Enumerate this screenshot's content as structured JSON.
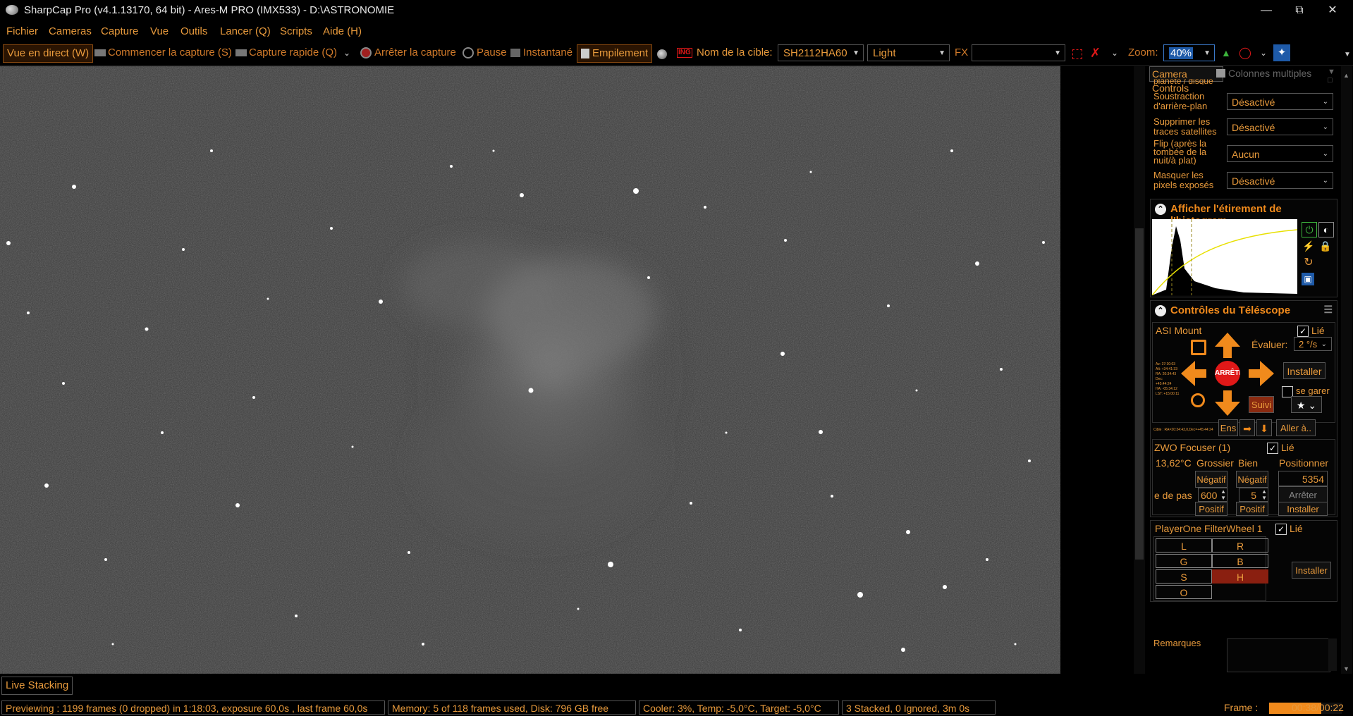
{
  "window": {
    "title": "SharpCap Pro (v4.1.13170, 64 bit) - Ares-M PRO (IMX533) - D:\\ASTRONOMIE"
  },
  "menu": [
    "Fichier",
    "Cameras",
    "Capture",
    "Vue",
    "Outils",
    "Lancer (Q)",
    "Scripts",
    "Aide (H)"
  ],
  "toolbar": {
    "live_view": "Vue en direct (W)",
    "start_capture": "Commencer la capture (S)",
    "quick_capture": "Capture rapide (Q)",
    "stop_capture": "Arrêter la capture",
    "pause": "Pause",
    "snapshot": "Instantané",
    "stacking": "Empilement",
    "target_label": "Nom de la cible:",
    "target_value": "SH2112HA60",
    "frame_type": "Light",
    "fx_label": "FX",
    "fx_value": "",
    "zoom_label": "Zoom:",
    "zoom_value": "40%",
    "ing_icon_text": "ING"
  },
  "panel": {
    "tabs": {
      "camera_controls": "Camera Controls",
      "multi_columns": "Colonnes multiples"
    },
    "processing": {
      "partial_label": "planète / disque",
      "rows": [
        {
          "label": "Soustraction d'arrière-plan",
          "value": "Désactivé"
        },
        {
          "label": "Supprimer les traces satellites",
          "value": "Désactivé"
        },
        {
          "label": "Flip (après la tombée de la nuit/à plat)",
          "value": "Aucun"
        },
        {
          "label": "Masquer les pixels exposés",
          "value": "Désactivé"
        }
      ]
    },
    "histogram": {
      "title": "Afficher l'étirement de l'histogram"
    },
    "telescope": {
      "title": "Contrôles du Téléscope",
      "mount_name": "ASI Mount",
      "linked": "Lié",
      "rate_label": "Évaluer:",
      "rate_value": "2 °/s",
      "stop_label": "ARRÊTE",
      "install": "Installer",
      "park": "se garer",
      "tracking": "Suivi",
      "ens": "Ens",
      "goto": "Aller à..",
      "coords": [
        "Az: 37:30:03",
        "Alt: +34:41:33",
        "RA: 20:34:43",
        "Dec: +45:44:24",
        "HA: -05:34:12",
        "LST: +15:00:11"
      ],
      "target_line": "Cible : RA=20:34:43,0,Dec=+45:44:24"
    },
    "focuser": {
      "name": "ZWO Focuser (1)",
      "linked": "Lié",
      "temperature": "13,62°C",
      "coarse": "Grossier",
      "fine": "Bien",
      "position_label": "Positionner",
      "negative": "Négatif",
      "positive": "Positif",
      "position_value": "5354",
      "step_label": "e de pas",
      "coarse_step": "600",
      "fine_step": "5",
      "stop": "Arrêter",
      "install": "Installer"
    },
    "filterwheel": {
      "name": "PlayerOne FilterWheel 1",
      "linked": "Lié",
      "filters": [
        "L",
        "R",
        "G",
        "B",
        "S",
        "H",
        "O"
      ],
      "active_filter": "H",
      "install": "Installer"
    },
    "notes_label": "Remarques"
  },
  "bottom_tab": "Live Stacking",
  "status": {
    "preview": "Previewing : 1199 frames (0 dropped) in 1:18:03, exposure 60,0s , last frame 60,0s",
    "memory": "Memory: 5 of 118 frames used, Disk: 796 GB free",
    "cooler": "Cooler: 3%, Temp: -5,0°C, Target: -5,0°C",
    "stacked": "3 Stacked, 0 Ignored, 3m 0s",
    "frame_label": "Frame :",
    "frame_progress": 0.72,
    "frame_time": "00:38/00:22"
  },
  "colors": {
    "accent": "#e89a3c",
    "stop_button": "#e01818",
    "active_filter": "#8a1f10",
    "arrow": "#f08a1c"
  }
}
